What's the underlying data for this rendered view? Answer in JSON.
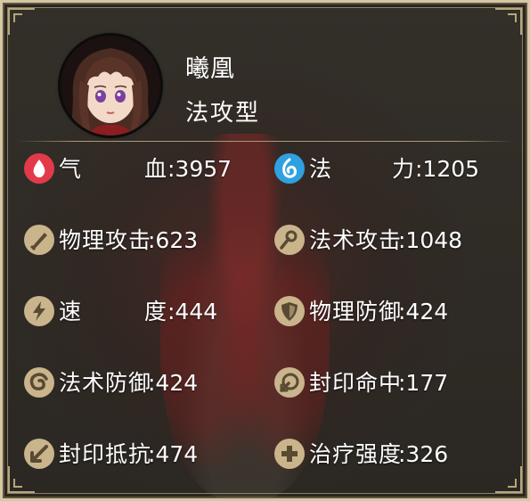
{
  "character": {
    "name": "曦凰",
    "type": "法攻型"
  },
  "stats": {
    "hp": {
      "char1": "气",
      "char2": "血",
      "value": ":3957",
      "icon": "blood-drop-icon",
      "color": "#e23a4b"
    },
    "mp": {
      "char1": "法",
      "char2": "力",
      "value": ":1205",
      "icon": "mana-swirl-icon",
      "color": "#2fa0e0"
    },
    "physical_attack": {
      "label": "物理攻击",
      "value": ":623",
      "icon": "sword-icon"
    },
    "magic_attack": {
      "label": "法术攻击",
      "value": ":1048",
      "icon": "wand-icon"
    },
    "speed": {
      "char1": "速",
      "char2": "度",
      "value": ":444",
      "icon": "lightning-icon"
    },
    "physical_defense": {
      "label": "物理防御",
      "value": ":424",
      "icon": "shield-icon"
    },
    "magic_defense": {
      "label": "法术防御",
      "value": ":424",
      "icon": "swirl-icon"
    },
    "seal_hit": {
      "label": "封印命中",
      "value": ":177",
      "icon": "seal-arrow-icon"
    },
    "seal_resist": {
      "label": "封印抵抗",
      "value": ":474",
      "icon": "arrow-icon"
    },
    "heal_power": {
      "label": "治疗强度",
      "value": ":326",
      "icon": "cross-icon"
    }
  },
  "colors": {
    "icon_bg": "#c9b48c",
    "icon_fg": "#5a4a32",
    "text": "#ffffff",
    "frame": "#d6c8a4"
  }
}
